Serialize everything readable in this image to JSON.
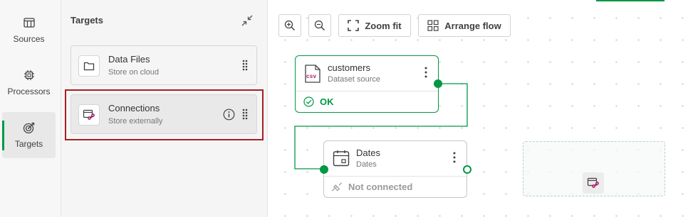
{
  "rail": {
    "items": [
      {
        "label": "Sources",
        "icon": "database-icon"
      },
      {
        "label": "Processors",
        "icon": "chip-icon"
      },
      {
        "label": "Targets",
        "icon": "target-icon",
        "active": true
      }
    ]
  },
  "panel": {
    "title": "Targets",
    "cards": [
      {
        "title": "Data Files",
        "subtitle": "Store on cloud",
        "icon": "folder-icon"
      },
      {
        "title": "Connections",
        "subtitle": "Store externally",
        "icon": "connections-icon",
        "selected": true
      }
    ]
  },
  "toolbar": {
    "zoom_fit_label": "Zoom fit",
    "arrange_flow_label": "Arrange flow"
  },
  "nodes": [
    {
      "title": "customers",
      "subtitle": "Dataset source",
      "status": "OK",
      "icon": "csv-file-icon",
      "icon_text": "csv"
    },
    {
      "title": "Dates",
      "subtitle": "Dates",
      "status": "Not connected",
      "icon": "calendar-icon"
    }
  ],
  "colors": {
    "accent": "#009845",
    "highlight": "#a61e22",
    "brand_pink": "#b0246a"
  }
}
